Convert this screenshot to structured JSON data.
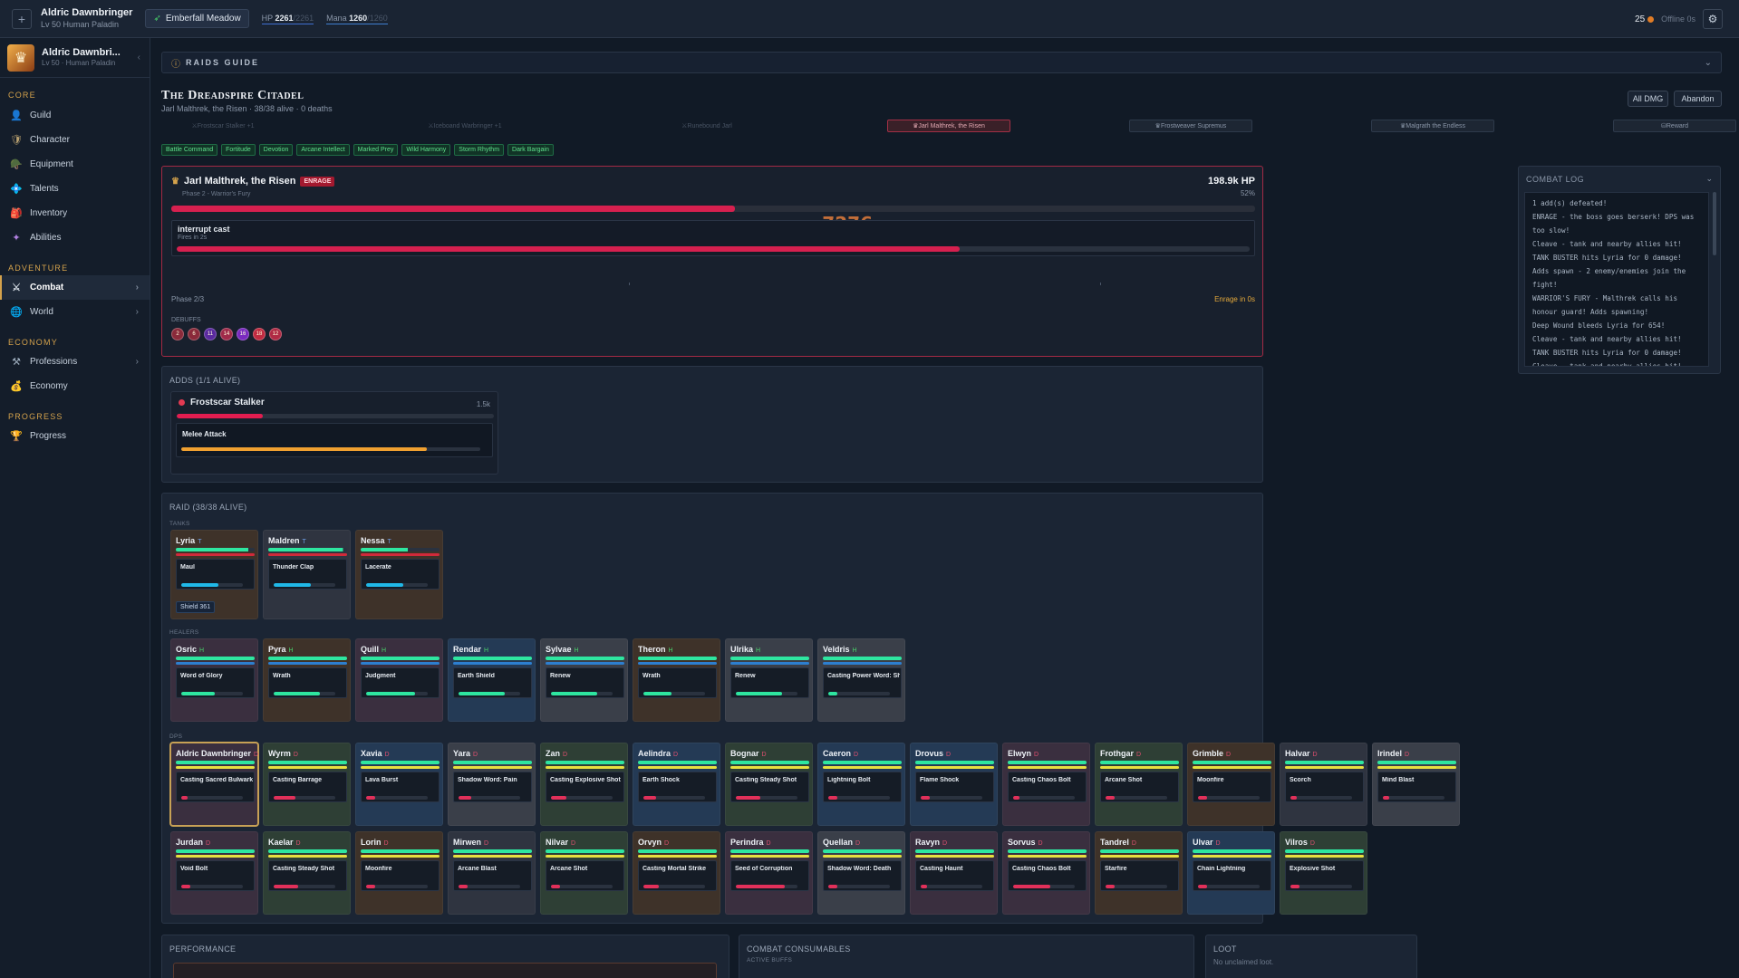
{
  "topbar": {
    "name": "Aldric Dawnbringer",
    "sub": "Lv 50 Human Paladin",
    "zone": "Emberfall Meadow",
    "hp_label": "HP",
    "hp": "2261",
    "hp_max": "2261",
    "mana_label": "Mana",
    "mana": "1260",
    "mana_max": "1260",
    "gold": "25",
    "offline": "Offline 0s"
  },
  "sidebar": {
    "name": "Aldric Dawnbri...",
    "sub": "Lv 50 · Human Paladin",
    "sections": [
      {
        "title": "CORE",
        "items": [
          {
            "label": "Guild",
            "icon": "👤",
            "color": "#d08a54"
          },
          {
            "label": "Character",
            "icon": "🛡",
            "color": "#b8a070"
          },
          {
            "label": "Equipment",
            "icon": "🪖",
            "color": "#d8b060"
          },
          {
            "label": "Talents",
            "icon": "💠",
            "color": "#b060e0"
          },
          {
            "label": "Inventory",
            "icon": "🎒",
            "color": "#d07040"
          },
          {
            "label": "Abilities",
            "icon": "✦",
            "color": "#b080e0"
          }
        ]
      },
      {
        "title": "ADVENTURE",
        "items": [
          {
            "label": "Combat",
            "icon": "⚔",
            "color": "#d0d8e0",
            "active": true,
            "arrow": true
          },
          {
            "label": "World",
            "icon": "🌐",
            "color": "#4aa0e8",
            "arrow": true
          }
        ]
      },
      {
        "title": "ECONOMY",
        "items": [
          {
            "label": "Professions",
            "icon": "⚒",
            "color": "#a0b0c0",
            "arrow": true
          },
          {
            "label": "Economy",
            "icon": "💰",
            "color": "#e8c040"
          }
        ]
      },
      {
        "title": "PROGRESS",
        "items": [
          {
            "label": "Progress",
            "icon": "🏆",
            "color": "#e8c040"
          }
        ]
      }
    ]
  },
  "guide": {
    "title": "RAIDS GUIDE"
  },
  "raid": {
    "title": "The Dreadspire Citadel",
    "sub": "Jarl Malthrek, the Risen · 38/38 alive · 0 deaths",
    "btn_dmg": "All DMG",
    "btn_abandon": "Abandon",
    "progress": [
      {
        "label": "Frostscar Stalker +1",
        "state": "done",
        "icon": "⚔"
      },
      {
        "label": "Iceboand Warbringer +1",
        "state": "done",
        "icon": "⚔"
      },
      {
        "label": "Runebound Jarl",
        "state": "done",
        "icon": "⚔"
      },
      {
        "label": "Jarl Malthrek, the Risen",
        "state": "cur",
        "icon": "♛"
      },
      {
        "label": "Frostweaver Supremus",
        "state": "up",
        "icon": "♛"
      },
      {
        "label": "Malgrath the Endless",
        "state": "up",
        "icon": "♛"
      },
      {
        "label": "Reward",
        "state": "up",
        "icon": "⛁"
      }
    ],
    "buffs": [
      "Battle Command",
      "Fortitude",
      "Devotion",
      "Arcane Intellect",
      "Marked Prey",
      "Wild Harmony",
      "Storm Rhythm",
      "Dark Bargain"
    ]
  },
  "boss": {
    "name": "Jarl Malthrek, the Risen",
    "enrage": "ENRAGE",
    "phase": "Phase 2 - Warrior's Fury",
    "hp": "198.9k HP",
    "pct": "52%",
    "hp_fraction": 0.52,
    "damage": "-7276",
    "cast_name": "interrupt cast",
    "cast_time": "Fires in 2s",
    "cast_fraction": 0.73,
    "phase_label": "Phase 2/3",
    "enrage_label": "Enrage in 0s",
    "debuffs_label": "DEBUFFS",
    "debuffs": [
      {
        "t": "2",
        "c": "#8a2a3a"
      },
      {
        "t": "6",
        "c": "#8a2a3a"
      },
      {
        "t": "11",
        "c": "#5a2aa0"
      },
      {
        "t": "14",
        "c": "#a02a4a"
      },
      {
        "t": "16",
        "c": "#7a2ac0"
      },
      {
        "t": "18",
        "c": "#c02a40"
      },
      {
        "t": "12",
        "c": "#b02a44"
      }
    ]
  },
  "log": {
    "title": "COMBAT LOG",
    "lines": [
      "1 add(s) defeated!",
      "ENRAGE - the boss goes berserk! DPS was too slow!",
      "Cleave - tank and nearby allies hit!",
      "TANK BUSTER hits Lyria for 0 damage!",
      "Adds spawn - 2 enemy/enemies join the fight!",
      "WARRIOR'S FURY - Malthrek calls his honour guard! Adds spawning!",
      "Deep Wound bleeds Lyria for 654!",
      "Cleave - tank and nearby allies hit!",
      "TANK BUSTER hits Lyria for 0 damage!",
      "Cleave - tank and nearby allies hit!"
    ]
  },
  "adds": {
    "title": "ADDS (1/1 ALIVE)",
    "name": "Frostscar Stalker",
    "hp": "1.5k",
    "hp_fraction": 0.27,
    "cast": "Melee Attack",
    "cast_fraction": 0.82
  },
  "raidpanel": {
    "title": "RAID (38/38 ALIVE)",
    "tanks_label": "TANKS",
    "healers_label": "HEALERS",
    "dps_label": "DPS",
    "tanks": [
      {
        "n": "Lyria",
        "r": "T",
        "cast": "Maul",
        "cf": 0.6,
        "hp": 0.92,
        "bg": "#3e3229",
        "shield": "Shield 361"
      },
      {
        "n": "Maldren",
        "r": "T",
        "cast": "Thunder Clap",
        "cf": 0.6,
        "hp": 0.95,
        "bg": "#2f3440"
      },
      {
        "n": "Nessa",
        "r": "T",
        "cast": "Lacerate",
        "cf": 0.6,
        "hp": 0.6,
        "bg": "#3e3229"
      }
    ],
    "healers": [
      {
        "n": "Osric",
        "r": "H",
        "cast": "Word of Glory",
        "cf": 0.55,
        "bg": "#3a2f3f"
      },
      {
        "n": "Pyra",
        "r": "H",
        "cast": "Wrath",
        "cf": 0.75,
        "bg": "#3e3229"
      },
      {
        "n": "Quill",
        "r": "H",
        "cast": "Judgment",
        "cf": 0.8,
        "bg": "#3a2f3f"
      },
      {
        "n": "Rendar",
        "r": "H",
        "cast": "Earth Shield",
        "cf": 0.75,
        "bg": "#243a55"
      },
      {
        "n": "Sylvae",
        "r": "H",
        "cast": "Renew",
        "cf": 0.75,
        "bg": "#3a3f49"
      },
      {
        "n": "Theron",
        "r": "H",
        "cast": "Wrath",
        "cf": 0.45,
        "bg": "#3e3229"
      },
      {
        "n": "Ulrika",
        "r": "H",
        "cast": "Renew",
        "cf": 0.75,
        "bg": "#3a3f49"
      },
      {
        "n": "Veldris",
        "r": "H",
        "cast": "Casting Power Word: Shield",
        "cf": 0.15,
        "bg": "#3a3f49"
      }
    ],
    "dps": [
      {
        "n": "Aldric Dawnbringer",
        "r": "D",
        "cast": "Casting Sacred Bulwark",
        "cf": 0.1,
        "bg": "#3a2f3f",
        "me": true
      },
      {
        "n": "Wyrm",
        "r": "D",
        "cast": "Casting Barrage",
        "cf": 0.35,
        "bg": "#2e3f35"
      },
      {
        "n": "Xavia",
        "r": "D",
        "cast": "Lava Burst",
        "cf": 0.15,
        "bg": "#243a55"
      },
      {
        "n": "Yara",
        "r": "D",
        "cast": "Shadow Word: Pain",
        "cf": 0.2,
        "bg": "#3a3f49"
      },
      {
        "n": "Zan",
        "r": "D",
        "cast": "Casting Explosive Shot",
        "cf": 0.25,
        "bg": "#2e3f35"
      },
      {
        "n": "Aelindra",
        "r": "D",
        "cast": "Earth Shock",
        "cf": 0.2,
        "bg": "#243a55"
      },
      {
        "n": "Bognar",
        "r": "D",
        "cast": "Casting Steady Shot",
        "cf": 0.4,
        "bg": "#2e3f35"
      },
      {
        "n": "Caeron",
        "r": "D",
        "cast": "Lightning Bolt",
        "cf": 0.15,
        "bg": "#243a55"
      },
      {
        "n": "Drovus",
        "r": "D",
        "cast": "Flame Shock",
        "cf": 0.15,
        "bg": "#243a55"
      },
      {
        "n": "Elwyn",
        "r": "D",
        "cast": "Casting Chaos Bolt",
        "cf": 0.1,
        "bg": "#3a2f3f"
      },
      {
        "n": "Frothgar",
        "r": "D",
        "cast": "Arcane Shot",
        "cf": 0.15,
        "bg": "#2e3f35"
      },
      {
        "n": "Grimble",
        "r": "D",
        "cast": "Moonfire",
        "cf": 0.15,
        "bg": "#3e3229"
      },
      {
        "n": "Halvar",
        "r": "D",
        "cast": "Scorch",
        "cf": 0.1,
        "bg": "#2f3440"
      },
      {
        "n": "Irindel",
        "r": "D",
        "cast": "Mind Blast",
        "cf": 0.1,
        "bg": "#3a3f49"
      },
      {
        "n": "Jurdan",
        "r": "D",
        "cast": "Void Bolt",
        "cf": 0.15,
        "bg": "#3a2f3f"
      },
      {
        "n": "Kaelar",
        "r": "D",
        "cast": "Casting Steady Shot",
        "cf": 0.4,
        "bg": "#2e3f35"
      },
      {
        "n": "Lorin",
        "r": "D",
        "cast": "Moonfire",
        "cf": 0.15,
        "bg": "#3e3229"
      },
      {
        "n": "Mirwen",
        "r": "D",
        "cast": "Arcane Blast",
        "cf": 0.15,
        "bg": "#2f3440"
      },
      {
        "n": "Nilvar",
        "r": "D",
        "cast": "Arcane Shot",
        "cf": 0.15,
        "bg": "#2e3f35"
      },
      {
        "n": "Orvyn",
        "r": "D",
        "cast": "Casting Mortal Strike",
        "cf": 0.25,
        "bg": "#3e3229"
      },
      {
        "n": "Perindra",
        "r": "D",
        "cast": "Seed of Corruption",
        "cf": 0.8,
        "bg": "#3a2f3f"
      },
      {
        "n": "Quellan",
        "r": "D",
        "cast": "Shadow Word: Death",
        "cf": 0.15,
        "bg": "#3a3f49"
      },
      {
        "n": "Ravyn",
        "r": "D",
        "cast": "Casting Haunt",
        "cf": 0.1,
        "bg": "#3a2f3f"
      },
      {
        "n": "Sorvus",
        "r": "D",
        "cast": "Casting Chaos Bolt",
        "cf": 0.6,
        "bg": "#3a2f3f"
      },
      {
        "n": "Tandrel",
        "r": "D",
        "cast": "Starfire",
        "cf": 0.15,
        "bg": "#3e3229"
      },
      {
        "n": "Ulvar",
        "r": "D",
        "cast": "Chain Lightning",
        "cf": 0.15,
        "bg": "#243a55"
      },
      {
        "n": "Vilros",
        "r": "D",
        "cast": "Explosive Shot",
        "cf": 0.15,
        "bg": "#2e3f35"
      }
    ]
  },
  "bottom": {
    "performance": "PERFORMANCE",
    "consumables": "COMBAT CONSUMABLES",
    "active_buffs": "ACTIVE BUFFS",
    "loot": "LOOT",
    "loot_empty": "No unclaimed loot."
  }
}
